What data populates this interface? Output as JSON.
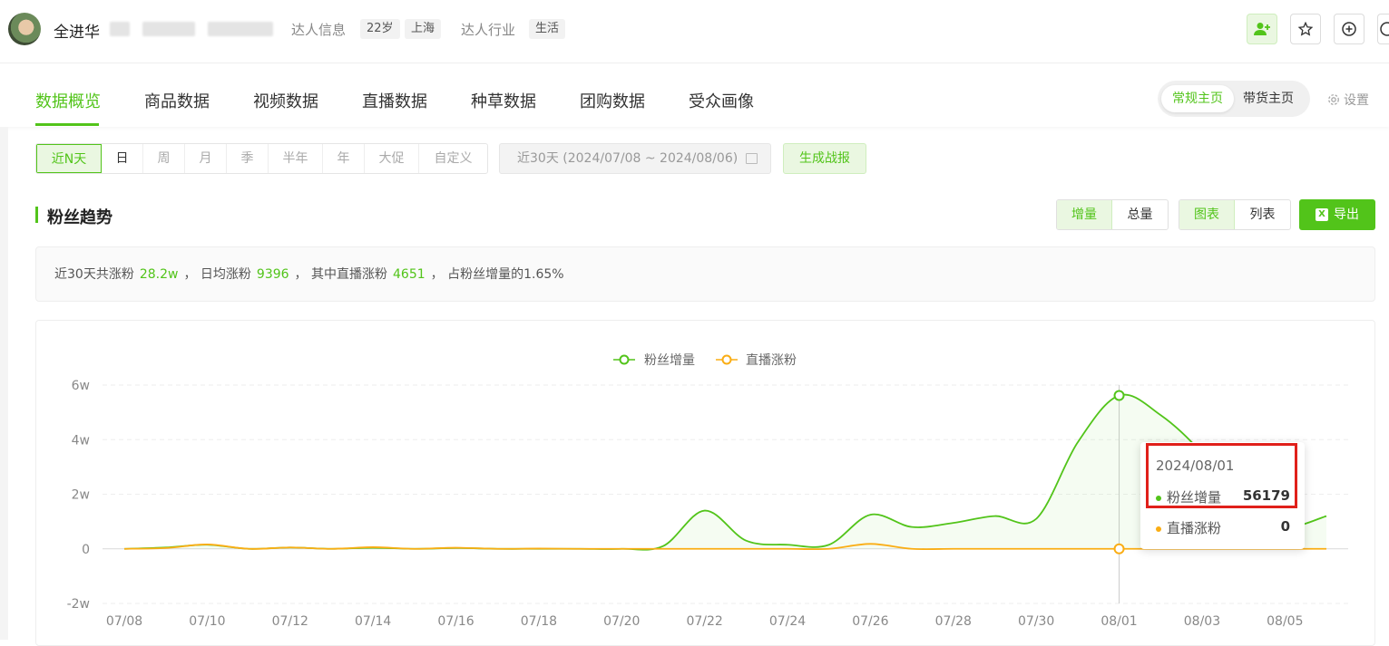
{
  "header": {
    "name": "全进华",
    "info_label": "达人信息",
    "age_tag": "22岁",
    "city_tag": "上海",
    "industry_label": "达人行业",
    "industry_tag": "生活"
  },
  "nav": {
    "tabs": [
      {
        "label": "数据概览",
        "active": true
      },
      {
        "label": "商品数据"
      },
      {
        "label": "视频数据"
      },
      {
        "label": "直播数据"
      },
      {
        "label": "种草数据"
      },
      {
        "label": "团购数据"
      },
      {
        "label": "受众画像"
      }
    ],
    "home_regular": "常规主页",
    "home_sales": "带货主页",
    "settings": "设置"
  },
  "filters": {
    "periods": [
      "近N天",
      "日",
      "周",
      "月",
      "季",
      "半年",
      "年",
      "大促",
      "自定义"
    ],
    "active_period": "近N天",
    "date_range": "近30天 (2024/07/08 ~ 2024/08/06)",
    "generate_button": "生成战报"
  },
  "section": {
    "title": "粉丝趋势",
    "increment": "增量",
    "total": "总量",
    "chart_view": "图表",
    "list_view": "列表",
    "export": "导出"
  },
  "summary": {
    "p1": "近30天共涨粉",
    "v1": "28.2w",
    "p2": "，  日均涨粉",
    "v2": "9396",
    "p3": "，  其中直播涨粉",
    "v3": "4651",
    "p4": "，  占粉丝增量的1.65%"
  },
  "tooltip": {
    "date": "2024/08/01",
    "series1_name": "粉丝增量",
    "series1_value": "56179",
    "series2_name": "直播涨粉",
    "series2_value": "0"
  },
  "colors": {
    "accent": "#52c41a",
    "live": "#faad14",
    "highlight": "#e0201a"
  },
  "chart_data": {
    "type": "line",
    "x": [
      "07/08",
      "07/09",
      "07/10",
      "07/11",
      "07/12",
      "07/13",
      "07/14",
      "07/15",
      "07/16",
      "07/17",
      "07/18",
      "07/19",
      "07/20",
      "07/21",
      "07/22",
      "07/23",
      "07/24",
      "07/25",
      "07/26",
      "07/27",
      "07/28",
      "07/29",
      "07/30",
      "07/31",
      "08/01",
      "08/02",
      "08/03",
      "08/04",
      "08/05",
      "08/06"
    ],
    "x_ticks": [
      "07/08",
      "07/10",
      "07/12",
      "07/14",
      "07/16",
      "07/18",
      "07/20",
      "07/22",
      "07/24",
      "07/26",
      "07/28",
      "07/30",
      "08/01",
      "08/03",
      "08/05"
    ],
    "y_ticks": [
      "6w",
      "4w",
      "2w",
      "0",
      "-2w"
    ],
    "ylim": [
      -20000,
      60000
    ],
    "legend_position": "top-center",
    "series": [
      {
        "name": "粉丝增量",
        "color": "#52c41a",
        "area": true,
        "values": [
          0,
          500,
          1500,
          0,
          500,
          0,
          400,
          0,
          300,
          0,
          0,
          0,
          0,
          1000,
          14000,
          3000,
          1500,
          1500,
          12500,
          8000,
          9500,
          12000,
          11000,
          39000,
          56179,
          49000,
          35000,
          15000,
          8000,
          12000
        ]
      },
      {
        "name": "直播涨粉",
        "color": "#faad14",
        "values": [
          0,
          300,
          1600,
          0,
          500,
          0,
          600,
          0,
          400,
          0,
          100,
          0,
          0,
          0,
          0,
          0,
          0,
          0,
          1800,
          0,
          0,
          0,
          0,
          0,
          0,
          0,
          0,
          0,
          0,
          0
        ]
      }
    ],
    "highlighted_index": 24
  }
}
